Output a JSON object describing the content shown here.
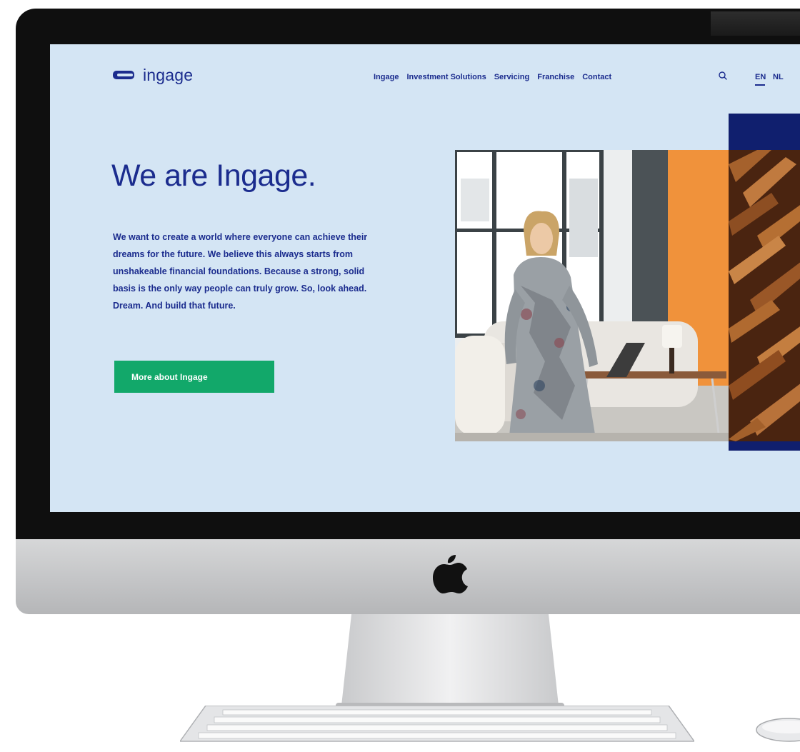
{
  "header": {
    "logo_text": "ingage",
    "nav": [
      {
        "label": "Ingage"
      },
      {
        "label": "Investment Solutions"
      },
      {
        "label": "Servicing"
      },
      {
        "label": "Franchise"
      },
      {
        "label": "Contact"
      }
    ],
    "search_icon": "search-icon",
    "languages": [
      {
        "label": "EN",
        "active": true
      },
      {
        "label": "NL",
        "active": false
      }
    ]
  },
  "hero": {
    "title": "We are Ingage.",
    "body": "We want to create a world where everyone can achieve their dreams for the future. We believe this always starts from unshakeable financial foundations. Because a strong, solid basis is the only way people can truly grow. So, look ahead. Dream. And build that future.",
    "cta_label": "More about Ingage"
  },
  "colors": {
    "screen_background": "#d4e5f4",
    "brand_navy": "#1b2c8e",
    "cta_green": "#12a86a",
    "panel_navy": "#101f6e",
    "accent_orange": "#f0923b"
  },
  "device": {
    "logo_icon": "apple-logo-icon"
  }
}
